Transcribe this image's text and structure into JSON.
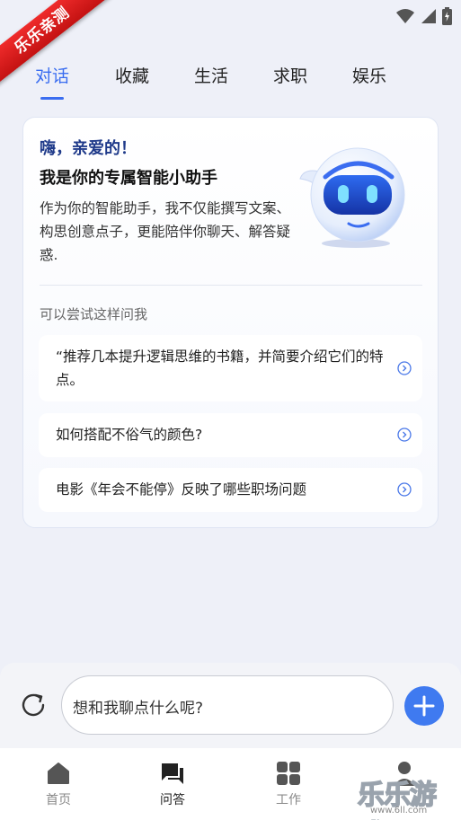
{
  "ribbon": "乐乐亲测",
  "tabs": [
    {
      "label": "对话",
      "active": true
    },
    {
      "label": "收藏",
      "active": false
    },
    {
      "label": "生活",
      "active": false
    },
    {
      "label": "求职",
      "active": false
    },
    {
      "label": "娱乐",
      "active": false
    }
  ],
  "card": {
    "greeting": "嗨，亲爱的！",
    "title": "我是你的专属智能小助手",
    "description": "作为你的智能助手，我不仅能撰写文案、构思创意点子，更能陪伴你聊天、解答疑惑.",
    "try_label": "可以尝试这样问我",
    "suggestions": [
      "“推荐几本提升逻辑思维的书籍，并简要介绍它们的特点。",
      "如何搭配不俗气的颜色?",
      "电影《年会不能停》反映了哪些职场问题"
    ]
  },
  "input": {
    "placeholder": "想和我聊点什么呢?"
  },
  "nav": [
    {
      "label": "首页",
      "icon": "home-icon",
      "active": false
    },
    {
      "label": "问答",
      "icon": "chat-icon",
      "active": true
    },
    {
      "label": "工作",
      "icon": "grid-icon",
      "active": false
    },
    {
      "label": "",
      "icon": "user-icon",
      "active": false
    }
  ],
  "watermark": {
    "text": "乐乐游戏",
    "url": "www.6ll.com"
  },
  "colors": {
    "accent": "#3a6df0",
    "brand_dark": "#1f3a8a",
    "ribbon": "#d81b1b"
  }
}
